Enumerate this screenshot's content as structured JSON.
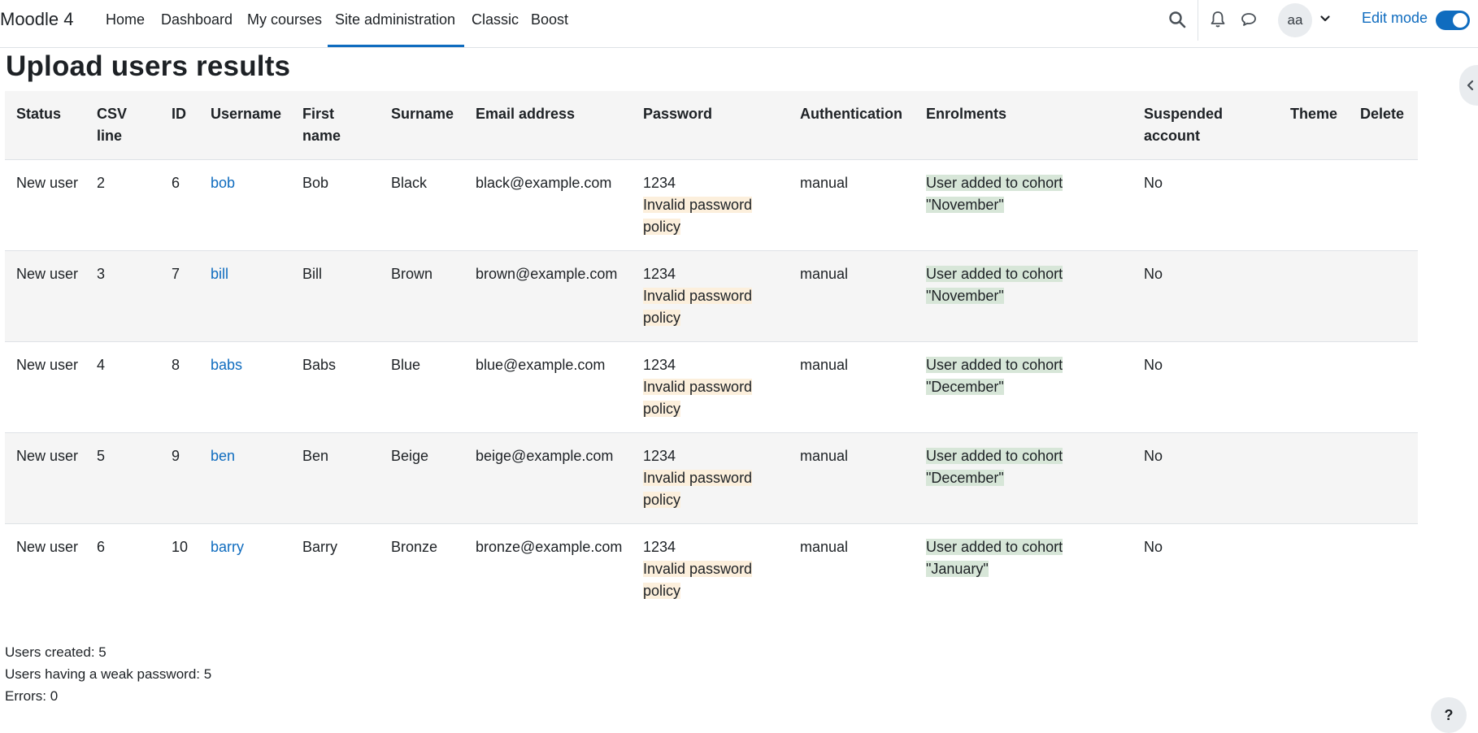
{
  "navbar": {
    "brand": "Moodle 4",
    "items": [
      {
        "label": "Home"
      },
      {
        "label": "Dashboard"
      },
      {
        "label": "My courses"
      },
      {
        "label": "Site administration"
      },
      {
        "label": "Classic"
      },
      {
        "label": "Boost"
      }
    ],
    "active_item": "Site administration",
    "user_initials": "aa",
    "edit_mode_label": "Edit mode",
    "edit_mode_on": true,
    "icons": [
      "search-icon",
      "bell-icon",
      "chat-icon",
      "chevron-down-icon"
    ]
  },
  "page": {
    "title": "Upload users results"
  },
  "table": {
    "headers": [
      "Status",
      "CSV line",
      "ID",
      "Username",
      "First name",
      "Surname",
      "Email address",
      "Password",
      "Authentication",
      "Enrolments",
      "Suspended account",
      "Theme",
      "Delete"
    ],
    "rows": [
      {
        "status": "New user",
        "csv_line": "2",
        "id": "6",
        "username": "bob",
        "first_name": "Bob",
        "surname": "Black",
        "email": "black@example.com",
        "password": "1234",
        "password_warning": "Invalid password policy",
        "auth": "manual",
        "enrolments": "User added to cohort \"November\"",
        "suspended": "No",
        "theme": "",
        "delete": ""
      },
      {
        "status": "New user",
        "csv_line": "3",
        "id": "7",
        "username": "bill",
        "first_name": "Bill",
        "surname": "Brown",
        "email": "brown@example.com",
        "password": "1234",
        "password_warning": "Invalid password policy",
        "auth": "manual",
        "enrolments": "User added to cohort \"November\"",
        "suspended": "No",
        "theme": "",
        "delete": ""
      },
      {
        "status": "New user",
        "csv_line": "4",
        "id": "8",
        "username": "babs",
        "first_name": "Babs",
        "surname": "Blue",
        "email": "blue@example.com",
        "password": "1234",
        "password_warning": "Invalid password policy",
        "auth": "manual",
        "enrolments": "User added to cohort \"December\"",
        "suspended": "No",
        "theme": "",
        "delete": ""
      },
      {
        "status": "New user",
        "csv_line": "5",
        "id": "9",
        "username": "ben",
        "first_name": "Ben",
        "surname": "Beige",
        "email": "beige@example.com",
        "password": "1234",
        "password_warning": "Invalid password policy",
        "auth": "manual",
        "enrolments": "User added to cohort \"December\"",
        "suspended": "No",
        "theme": "",
        "delete": ""
      },
      {
        "status": "New user",
        "csv_line": "6",
        "id": "10",
        "username": "barry",
        "first_name": "Barry",
        "surname": "Bronze",
        "email": "bronze@example.com",
        "password": "1234",
        "password_warning": "Invalid password policy",
        "auth": "manual",
        "enrolments": "User added to cohort \"January\"",
        "suspended": "No",
        "theme": "",
        "delete": ""
      }
    ]
  },
  "summary": {
    "created": "Users created: 5",
    "weak": "Users having a weak password: 5",
    "errors": "Errors: 0"
  },
  "help": {
    "label": "?"
  },
  "colors": {
    "accent": "#0f6cbf",
    "warning_bg": "#fcefdc",
    "success_bg": "#d7e6d8",
    "stripe": "#f5f5f5"
  }
}
